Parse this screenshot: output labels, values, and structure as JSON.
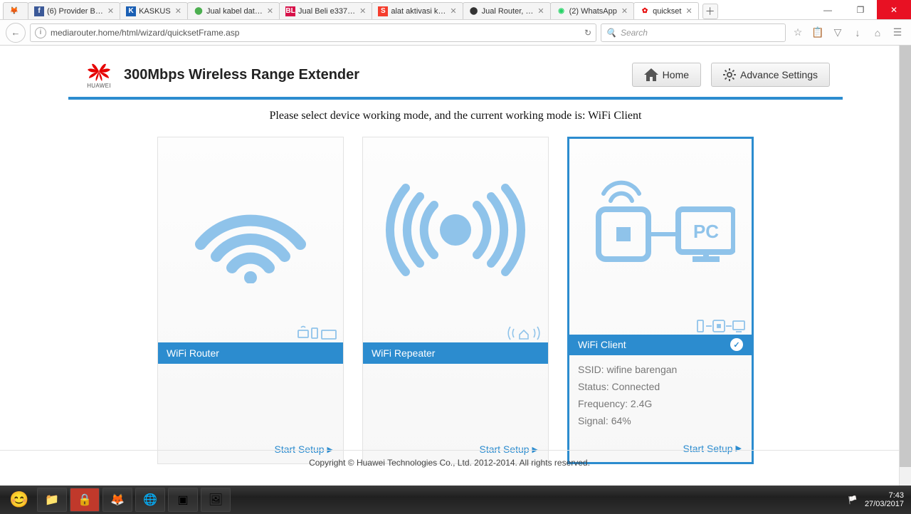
{
  "window": {
    "tabs": [
      {
        "label": "(6) Provider B…"
      },
      {
        "label": "KASKUS"
      },
      {
        "label": "Jual kabel dat…"
      },
      {
        "label": "Jual Beli e337…"
      },
      {
        "label": "alat aktivasi k…"
      },
      {
        "label": "Jual Router, …"
      },
      {
        "label": "(2) WhatsApp"
      },
      {
        "label": "quickset"
      }
    ],
    "active_tab": 7,
    "min": "—",
    "max": "❐",
    "close": "✕"
  },
  "nav": {
    "back": "←",
    "info": "i",
    "url": "mediarouter.home/html/wizard/quicksetFrame.asp",
    "reload": "↻",
    "search_placeholder": "Search",
    "star": "☆"
  },
  "page": {
    "logo_sub": "HUAWEI",
    "title": "300Mbps Wireless Range Extender",
    "home_btn": "Home",
    "adv_btn": "Advance Settings",
    "instruction": "Please select device working mode, and the current working mode is: WiFi Client",
    "cards": [
      {
        "label": "WiFi Router",
        "start": "Start Setup"
      },
      {
        "label": "WiFi Repeater",
        "start": "Start Setup"
      },
      {
        "label": "WiFi Client",
        "start": "Start Setup",
        "ssid": "SSID: wifine barengan",
        "status": "Status: Connected",
        "freq": "Frequency: 2.4G",
        "signal": "Signal: 64%"
      }
    ],
    "footer": "Copyright © Huawei Technologies Co., Ltd. 2012-2014. All rights reserved."
  },
  "taskbar": {
    "time": "7:43",
    "date": "27/03/2017"
  }
}
